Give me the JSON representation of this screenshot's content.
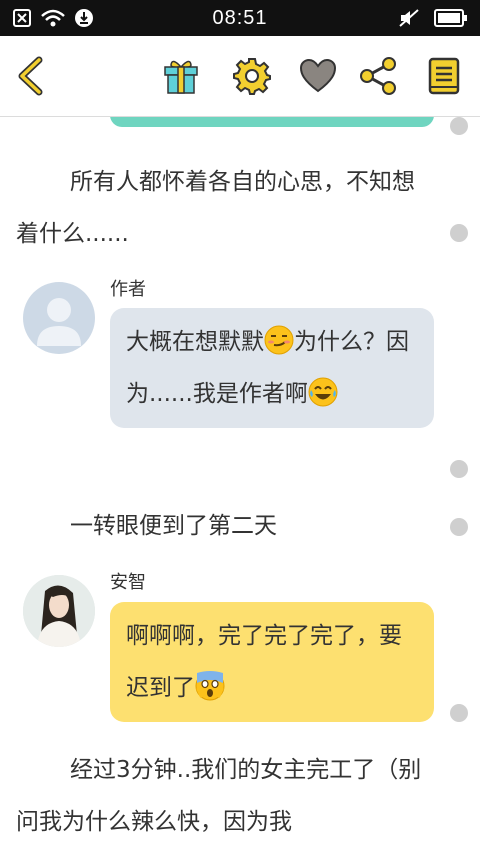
{
  "status_bar": {
    "time": "08:51"
  },
  "toolbar": {
    "back": "back-arrow-icon",
    "gift": "gift-icon",
    "settings": "gear-icon",
    "like": "heart-icon",
    "share": "share-icon",
    "catalog": "book-icon"
  },
  "colors": {
    "accent": "#f2cf2f",
    "author_bubble": "#dfe5ec",
    "anzhi_bubble": "#fde070",
    "prev_bubble": "#6fd5c0"
  },
  "story": {
    "narration1": "所有人都怀着各自的心思，不知想着什么......",
    "author": {
      "name": "作者",
      "line1_a": "大概在想默默",
      "line1_b": "为什么？因为......我是作者啊"
    },
    "narration2": "一转眼便到了第二天",
    "anzhi": {
      "name": "安智",
      "text": "啊啊啊，完了完了完了，要迟到了"
    },
    "narration3": "经过3分钟..我们的女主完工了（别问我为什么辣么快，因为我"
  }
}
